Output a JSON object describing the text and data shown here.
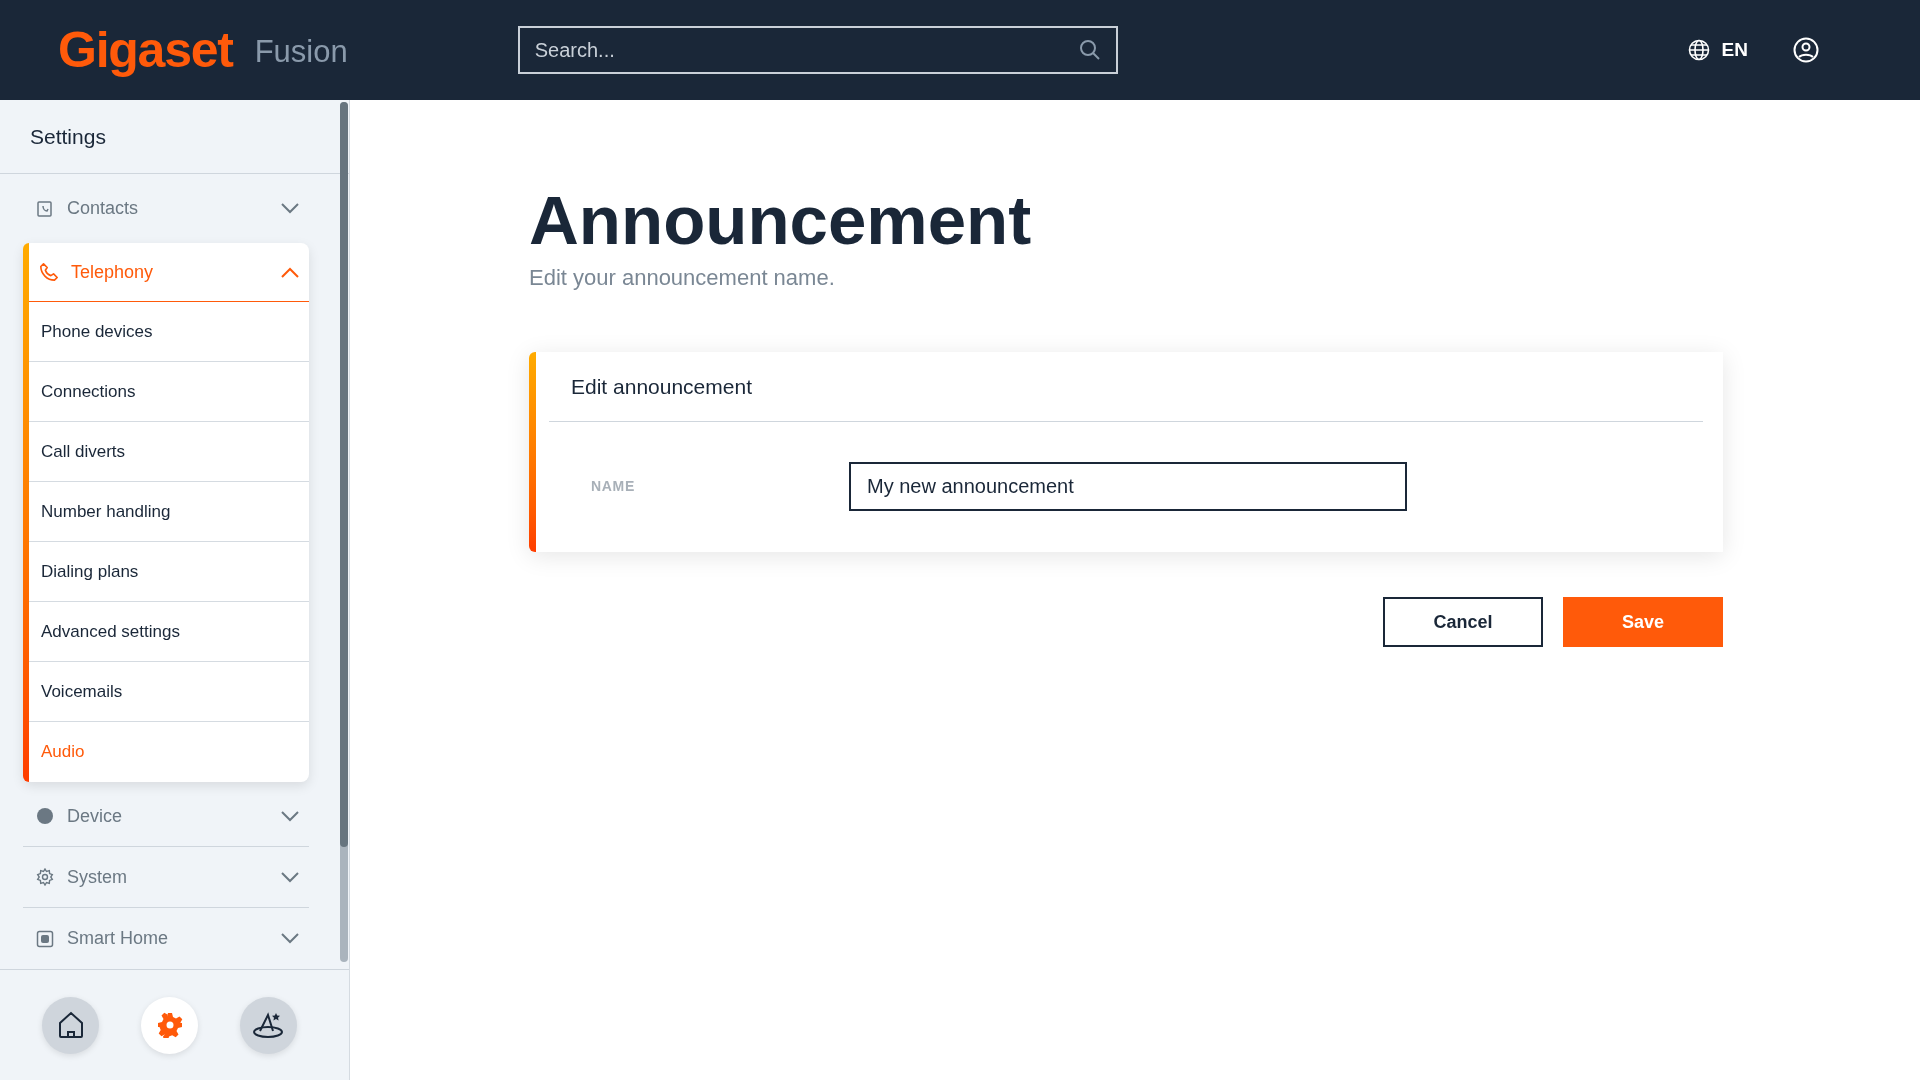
{
  "header": {
    "logo": "Gigaset",
    "product": "Fusion",
    "search": {
      "placeholder": "Search..."
    },
    "language": "EN"
  },
  "sidebar": {
    "title": "Settings",
    "sections": [
      {
        "label": "Contacts",
        "expanded": false
      },
      {
        "label": "Telephony",
        "expanded": true,
        "children": [
          {
            "label": "Phone devices",
            "selected": false
          },
          {
            "label": "Connections",
            "selected": false
          },
          {
            "label": "Call diverts",
            "selected": false
          },
          {
            "label": "Number handling",
            "selected": false
          },
          {
            "label": "Dialing plans",
            "selected": false
          },
          {
            "label": "Advanced settings",
            "selected": false
          },
          {
            "label": "Voicemails",
            "selected": false
          },
          {
            "label": "Audio",
            "selected": true
          }
        ]
      },
      {
        "label": "Device",
        "expanded": false
      },
      {
        "label": "System",
        "expanded": false
      },
      {
        "label": "Smart Home",
        "expanded": false
      }
    ],
    "bottom_nav": [
      {
        "selected": false
      },
      {
        "selected": true
      },
      {
        "selected": false
      }
    ]
  },
  "main": {
    "title": "Announcement",
    "subtitle": "Edit your announcement name.",
    "card": {
      "title": "Edit announcement",
      "field": {
        "label": "NAME",
        "value": "My new announcement"
      }
    },
    "buttons": [
      {
        "label": "Cancel",
        "kind": "secondary"
      },
      {
        "label": "Save",
        "kind": "primary"
      }
    ]
  }
}
